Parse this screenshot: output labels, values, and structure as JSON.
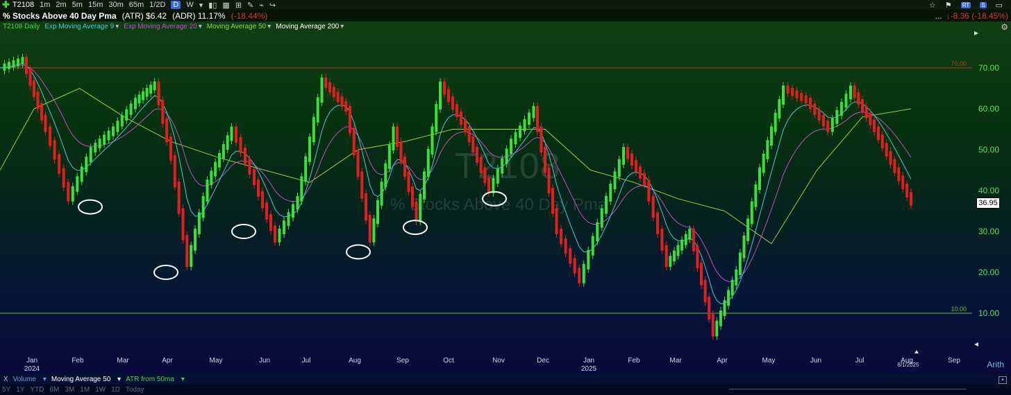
{
  "toolbar": {
    "symbol": "T2108",
    "intervals": [
      "1m",
      "2m",
      "5m",
      "15m",
      "30m",
      "65m",
      "1/2D"
    ],
    "active_interval": "D",
    "weekly": "W"
  },
  "header": {
    "name": "% Stocks Above 40 Day Pma",
    "atr": "(ATR) $6.42",
    "adr": "(ADR) 11.17%",
    "change_pct": "(-18.44%)",
    "right_dots": "...",
    "right_change": "↓-8.36 (-18.45%)"
  },
  "legend": [
    {
      "label": "T2108 Daily",
      "color": "#4fd24f"
    },
    {
      "label": "Exp Moving Average 9",
      "color": "#48c8d8"
    },
    {
      "label": "Exp Moving Average 20",
      "color": "#c050c0"
    },
    {
      "label": "Moving Average 50",
      "color": "#9fce4a"
    },
    {
      "label": "Moving Average 200",
      "color": "#ffffff"
    }
  ],
  "watermark": {
    "symbol": "T2108",
    "name": "% Stocks Above 40 Day Pma"
  },
  "price_tag": "36.95",
  "date_marker": "8/1/2025",
  "scale_mode": "Arith",
  "chart_data": {
    "type": "candlestick",
    "title": "% Stocks Above 40 Day Pma",
    "y_ticks": [
      "10.00",
      "20.00",
      "30.00",
      "40.00",
      "50.00",
      "60.00",
      "70.00"
    ],
    "ylim": [
      3,
      82
    ],
    "reference_lines": [
      {
        "value": 70,
        "label": "70.00",
        "color": "#c0392b"
      },
      {
        "value": 10,
        "label": "10.00",
        "color": "#6abf40"
      }
    ],
    "x_months": [
      {
        "label": "Jan",
        "year": "2024"
      },
      {
        "label": "Feb"
      },
      {
        "label": "Mar"
      },
      {
        "label": "Apr"
      },
      {
        "label": "May"
      },
      {
        "label": "Jun"
      },
      {
        "label": "Jul"
      },
      {
        "label": "Aug"
      },
      {
        "label": "Sep"
      },
      {
        "label": "Oct"
      },
      {
        "label": "Nov"
      },
      {
        "label": "Dec"
      },
      {
        "label": "Jan",
        "year": "2025"
      },
      {
        "label": "Feb"
      },
      {
        "label": "Mar"
      },
      {
        "label": "Apr"
      },
      {
        "label": "May"
      },
      {
        "label": "Jun"
      },
      {
        "label": "Jul"
      },
      {
        "label": "Aug"
      },
      {
        "label": "Sep"
      }
    ],
    "close_series": [
      {
        "month": "Dec 2023",
        "value": 70
      },
      {
        "month": "Jan 2024",
        "value": 72
      },
      {
        "month": "Jan 2024",
        "value": 55
      },
      {
        "month": "Feb 2024",
        "value": 38
      },
      {
        "month": "Feb 2024",
        "value": 50
      },
      {
        "month": "Mar 2024",
        "value": 55
      },
      {
        "month": "Mar 2024",
        "value": 62
      },
      {
        "month": "Apr 2024",
        "value": 66
      },
      {
        "month": "Apr 2024",
        "value": 48
      },
      {
        "month": "Apr 2024",
        "value": 22
      },
      {
        "month": "May 2024",
        "value": 42
      },
      {
        "month": "May 2024",
        "value": 55
      },
      {
        "month": "Jun 2024",
        "value": 42
      },
      {
        "month": "Jun 2024",
        "value": 28
      },
      {
        "month": "Jul 2024",
        "value": 38
      },
      {
        "month": "Jul 2024",
        "value": 67
      },
      {
        "month": "Aug 2024",
        "value": 60
      },
      {
        "month": "Aug 2024",
        "value": 28
      },
      {
        "month": "Sep 2024",
        "value": 55
      },
      {
        "month": "Sep 2024",
        "value": 33
      },
      {
        "month": "Oct 2024",
        "value": 66
      },
      {
        "month": "Oct 2024",
        "value": 55
      },
      {
        "month": "Nov 2024",
        "value": 40
      },
      {
        "month": "Nov 2024",
        "value": 52
      },
      {
        "month": "Dec 2024",
        "value": 60
      },
      {
        "month": "Dec 2024",
        "value": 30
      },
      {
        "month": "Jan 2025",
        "value": 18
      },
      {
        "month": "Jan 2025",
        "value": 35
      },
      {
        "month": "Feb 2025",
        "value": 50
      },
      {
        "month": "Feb 2025",
        "value": 42
      },
      {
        "month": "Mar 2025",
        "value": 22
      },
      {
        "month": "Mar 2025",
        "value": 30
      },
      {
        "month": "Apr 2025",
        "value": 5
      },
      {
        "month": "Apr 2025",
        "value": 20
      },
      {
        "month": "May 2025",
        "value": 45
      },
      {
        "month": "May 2025",
        "value": 65
      },
      {
        "month": "Jun 2025",
        "value": 62
      },
      {
        "month": "Jun 2025",
        "value": 55
      },
      {
        "month": "Jul 2025",
        "value": 65
      },
      {
        "month": "Jul 2025",
        "value": 55
      },
      {
        "month": "Aug 2025",
        "value": 37
      }
    ],
    "ma50_series": [
      {
        "month": "Dec 2023",
        "value": 45
      },
      {
        "month": "Jan 2024",
        "value": 60
      },
      {
        "month": "Feb 2024",
        "value": 65
      },
      {
        "month": "Mar 2024",
        "value": 58
      },
      {
        "month": "Apr 2024",
        "value": 52
      },
      {
        "month": "May 2024",
        "value": 48
      },
      {
        "month": "Jun 2024",
        "value": 45
      },
      {
        "month": "Jul 2024",
        "value": 42
      },
      {
        "month": "Aug 2024",
        "value": 50
      },
      {
        "month": "Sep 2024",
        "value": 52
      },
      {
        "month": "Oct 2024",
        "value": 55
      },
      {
        "month": "Nov 2024",
        "value": 55
      },
      {
        "month": "Dec 2024",
        "value": 55
      },
      {
        "month": "Jan 2025",
        "value": 45
      },
      {
        "month": "Feb 2025",
        "value": 42
      },
      {
        "month": "Mar 2025",
        "value": 38
      },
      {
        "month": "Apr 2025",
        "value": 35
      },
      {
        "month": "May 2025",
        "value": 27
      },
      {
        "month": "Jun 2025",
        "value": 45
      },
      {
        "month": "Jul 2025",
        "value": 58
      },
      {
        "month": "Aug 2025",
        "value": 60
      }
    ],
    "circled_lows": [
      {
        "month": "Feb 2024",
        "value": 36
      },
      {
        "month": "Apr 2024",
        "value": 20
      },
      {
        "month": "Jun 2024",
        "value": 30
      },
      {
        "month": "Aug 2024",
        "value": 25
      },
      {
        "month": "Sep 2024",
        "value": 31
      },
      {
        "month": "Nov 2024",
        "value": 38
      }
    ],
    "grid": false,
    "legend_position": "top-left"
  },
  "bottom_panel": {
    "close": "X",
    "items": [
      "Volume",
      "Moving Average 50",
      "ATR from 50ma"
    ],
    "ranges": [
      "5Y",
      "1Y",
      "YTD",
      "6M",
      "3M",
      "1M",
      "1W",
      "1D",
      "Today"
    ]
  }
}
